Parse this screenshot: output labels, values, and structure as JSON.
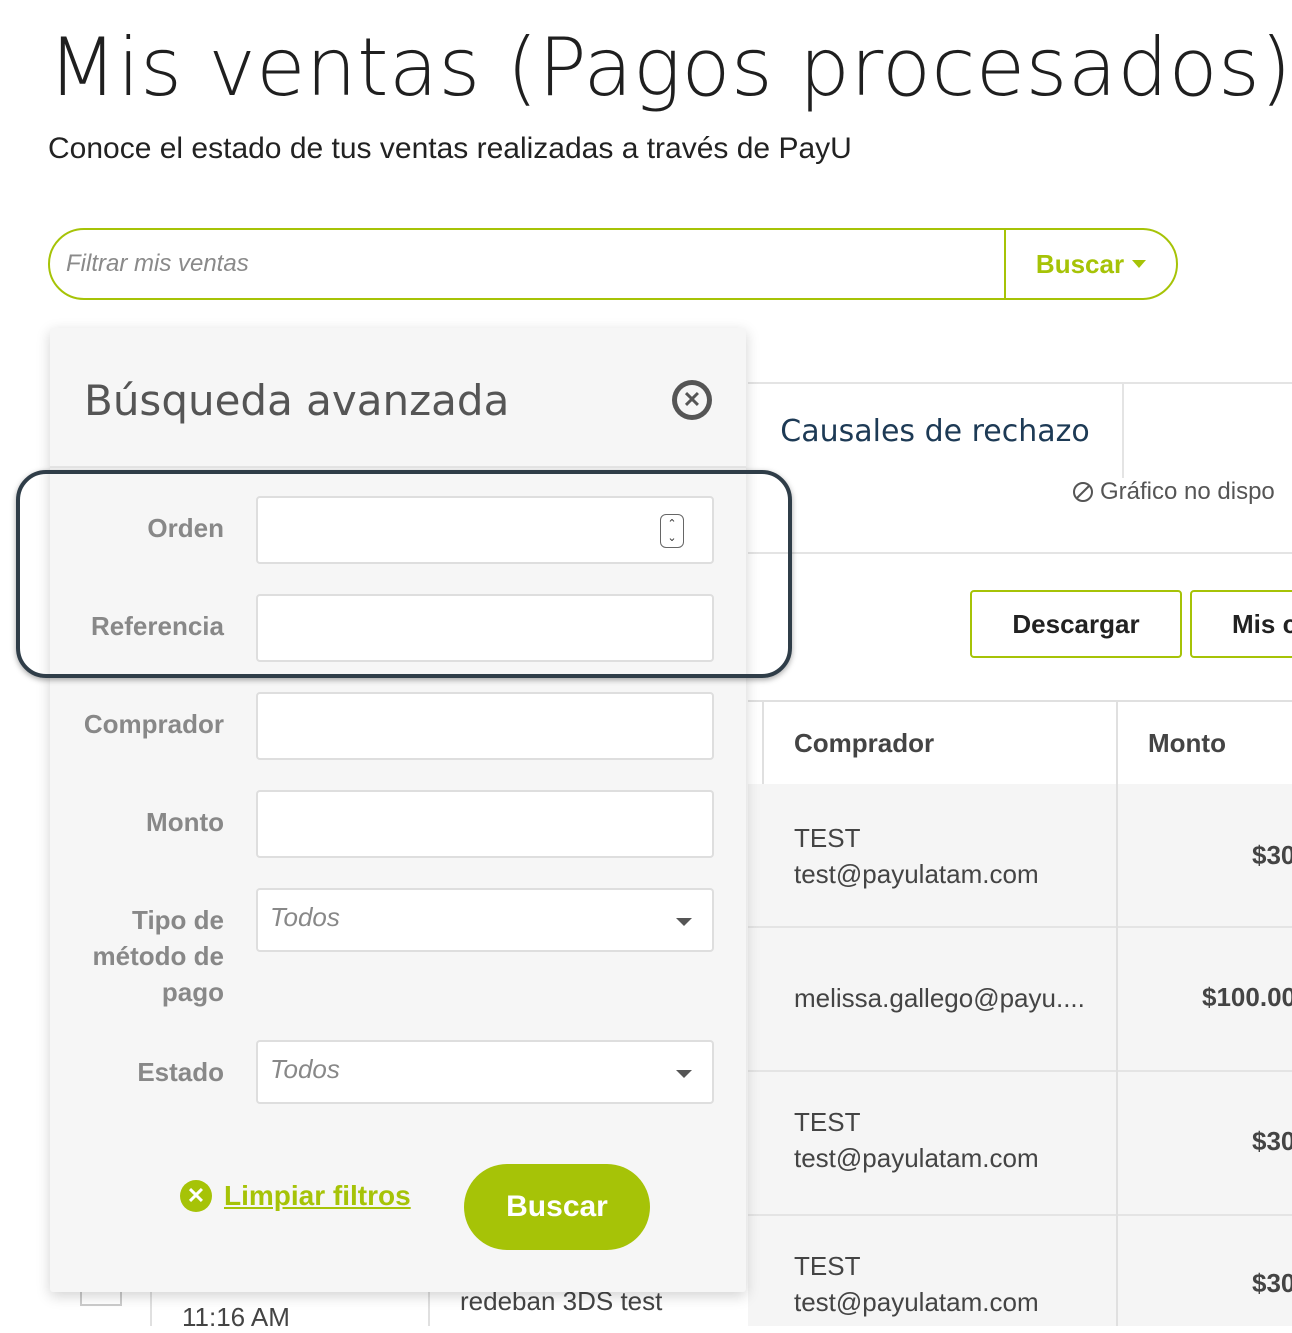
{
  "header": {
    "title": "Mis ventas (Pagos procesados)",
    "subtitle": "Conoce el estado de tus ventas realizadas a través de PayU"
  },
  "search": {
    "placeholder": "Filtrar mis ventas",
    "button_label": "Buscar"
  },
  "background": {
    "tab_label": "Causales de rechazo",
    "chart_unavailable": "Gráfico no dispo",
    "download_label": "Descargar",
    "second_button_label": "Mis c",
    "table": {
      "columns": [
        "Comprador",
        "Monto"
      ],
      "rows": [
        {
          "buyer_name": "TEST",
          "buyer_email": "test@payulatam.com",
          "amount": "$30"
        },
        {
          "buyer_name": "",
          "buyer_email": "melissa.gallego@payu....",
          "amount": "$100.00"
        },
        {
          "buyer_name": "TEST",
          "buyer_email": "test@payulatam.com",
          "amount": "$30"
        },
        {
          "buyer_name": "TEST",
          "buyer_email": "test@payulatam.com",
          "amount": "$30"
        }
      ],
      "fragment_time": "11:16 AM",
      "fragment_desc": "redeban 3DS test"
    }
  },
  "advanced_search": {
    "title": "Búsqueda avanzada",
    "fields": {
      "orden": "Orden",
      "referencia": "Referencia",
      "comprador": "Comprador",
      "monto": "Monto",
      "tipo_metodo": "Tipo de método de pago",
      "estado": "Estado"
    },
    "tipo_metodo_value": "Todos",
    "estado_value": "Todos",
    "clear_label": "Limpiar filtros",
    "search_label": "Buscar"
  },
  "colors": {
    "accent": "#a6c307",
    "tab_text": "#1d3a55",
    "highlight_border": "#2f3d48"
  }
}
